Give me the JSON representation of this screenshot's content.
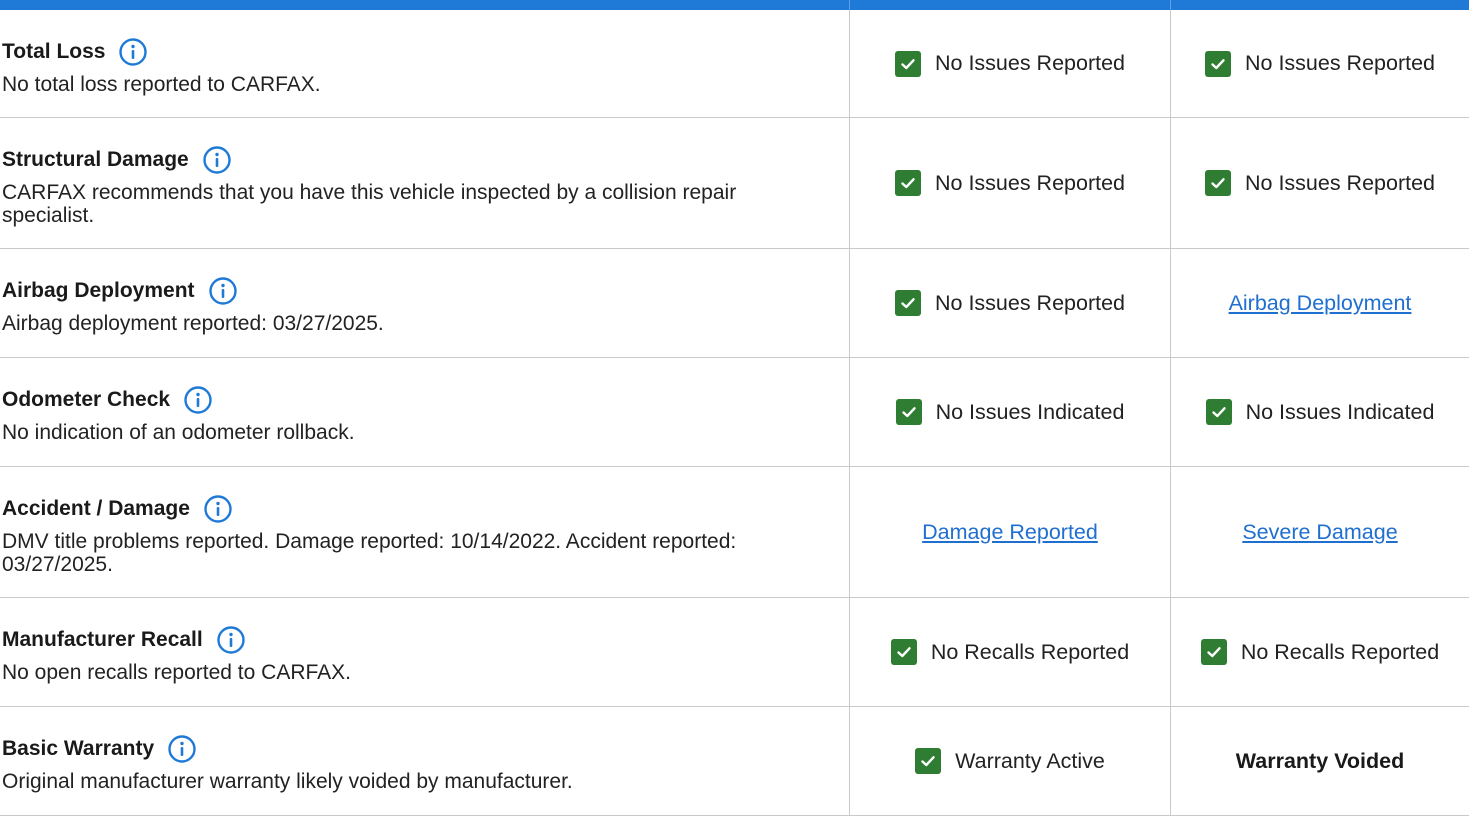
{
  "rows": [
    {
      "title": "Total Loss",
      "description": "No total loss reported to CARFAX.",
      "col1": {
        "kind": "check",
        "text": "No Issues Reported"
      },
      "col2": {
        "kind": "check",
        "text": "No Issues Reported"
      }
    },
    {
      "title": "Structural Damage",
      "description": "CARFAX recommends that you have this vehicle inspected by a collision repair specialist.",
      "col1": {
        "kind": "check",
        "text": "No Issues Reported"
      },
      "col2": {
        "kind": "check",
        "text": "No Issues Reported"
      }
    },
    {
      "title": "Airbag Deployment",
      "description": "Airbag deployment reported: 03/27/2025.",
      "col1": {
        "kind": "check",
        "text": "No Issues Reported"
      },
      "col2": {
        "kind": "link",
        "text": "Airbag Deployment"
      }
    },
    {
      "title": "Odometer Check",
      "description": "No indication of an odometer rollback.",
      "col1": {
        "kind": "check",
        "text": "No Issues Indicated"
      },
      "col2": {
        "kind": "check",
        "text": "No Issues Indicated"
      }
    },
    {
      "title": "Accident / Damage",
      "description": "DMV title problems reported. Damage reported: 10/14/2022. Accident reported: 03/27/2025.",
      "col1": {
        "kind": "link",
        "text": "Damage Reported"
      },
      "col2": {
        "kind": "link",
        "text": "Severe Damage"
      }
    },
    {
      "title": "Manufacturer Recall",
      "description": "No open recalls reported to CARFAX.",
      "col1": {
        "kind": "check",
        "text": "No Recalls Reported"
      },
      "col2": {
        "kind": "check",
        "text": "No Recalls Reported"
      }
    },
    {
      "title": "Basic Warranty",
      "description": "Original manufacturer warranty likely voided by manufacturer.",
      "col1": {
        "kind": "check",
        "text": "Warranty Active"
      },
      "col2": {
        "kind": "bold",
        "text": "Warranty Voided"
      }
    }
  ],
  "colors": {
    "header_bar": "#1f7ad7",
    "check_green": "#2e7d32",
    "link_blue": "#1f6fd1",
    "info_blue": "#1f7ad7",
    "divider": "#c9c9c9"
  },
  "icons": {
    "info": "info-icon",
    "check": "checkmark-icon"
  }
}
